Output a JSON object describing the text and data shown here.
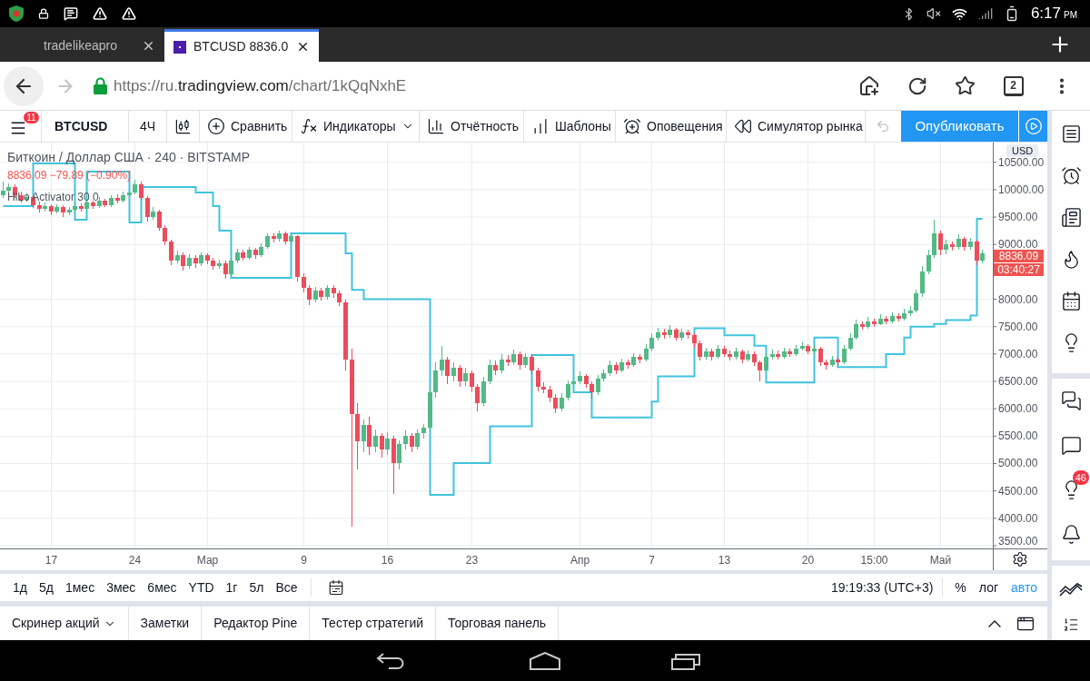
{
  "status_bar": {
    "time": "6:17",
    "period": "PM"
  },
  "browser": {
    "tabs": [
      {
        "title": "tradelikeapro",
        "favicon": false,
        "selected": false
      },
      {
        "title": "BTCUSD 8836.0",
        "favicon": true,
        "selected": true
      }
    ],
    "address_bar": {
      "back_enabled": true,
      "forward_enabled": false,
      "url": {
        "prefix": "https://ru.",
        "domain": "tradingview.com",
        "path": "/chart/1kQqNxhE"
      },
      "tab_count": "2"
    }
  },
  "toolbar": {
    "menu_badge": "11",
    "symbol": "BTCUSD",
    "interval": "4Ч",
    "items": [
      {
        "kind": "compare",
        "label": "Сравнить",
        "dropdown": false
      },
      {
        "kind": "indicators",
        "label": "Индикаторы",
        "dropdown": true
      },
      {
        "kind": "financials",
        "label": "Отчётность",
        "dropdown": false
      },
      {
        "kind": "templates",
        "label": "Шаблоны",
        "dropdown": false
      },
      {
        "kind": "alerts",
        "label": "Оповещения",
        "dropdown": false
      },
      {
        "kind": "replay",
        "label": "Симулятор рынка",
        "dropdown": false
      }
    ],
    "undo_enabled": false,
    "publish": "Опубликовать"
  },
  "chart": {
    "legend": {
      "title": "Биткоин / Доллар США · 240 · BITSTAMP",
      "change": "8836.09 −79.89 (−0.90%)",
      "indicator": "HiLo Activator 30 0"
    },
    "price_axis": {
      "currency": "USD",
      "last_price": "8836.09",
      "countdown": "03:40:27"
    },
    "chart_data": [
      {
        "type": "candlestick",
        "grid": true,
        "ylim": [
          3450,
          10860
        ],
        "yticks": [
          {
            "value": 3500,
            "label": "3500.00"
          },
          {
            "value": 4000,
            "label": "4000.00"
          },
          {
            "value": 4500,
            "label": "4500.00"
          },
          {
            "value": 5000,
            "label": "5000.00"
          },
          {
            "value": 5500,
            "label": "5500.00"
          },
          {
            "value": 6000,
            "label": "6000.00"
          },
          {
            "value": 6500,
            "label": "6500.00"
          },
          {
            "value": 7000,
            "label": "7000.00"
          },
          {
            "value": 7500,
            "label": "7500.00"
          },
          {
            "value": 8000,
            "label": "8000.00"
          },
          {
            "value": 9000,
            "label": "9000.00"
          },
          {
            "value": 9500,
            "label": "9500.00"
          },
          {
            "value": 10000,
            "label": "10000.00"
          },
          {
            "value": 10500,
            "label": "10500.00"
          }
        ],
        "categories": [
          null,
          null,
          null,
          null,
          null,
          null,
          null,
          null,
          "17",
          null,
          null,
          null,
          null,
          null,
          null,
          null,
          null,
          null,
          null,
          null,
          null,
          null,
          "24",
          null,
          null,
          null,
          null,
          null,
          null,
          null,
          null,
          null,
          null,
          null,
          "Мар",
          null,
          null,
          null,
          null,
          null,
          null,
          null,
          null,
          null,
          null,
          null,
          null,
          null,
          null,
          null,
          "9",
          null,
          null,
          null,
          null,
          null,
          null,
          null,
          null,
          null,
          null,
          null,
          null,
          null,
          "16",
          null,
          null,
          null,
          null,
          null,
          null,
          null,
          null,
          null,
          null,
          null,
          null,
          null,
          "23",
          null,
          null,
          null,
          null,
          null,
          null,
          null,
          null,
          null,
          null,
          null,
          null,
          null,
          null,
          null,
          null,
          null,
          "Апр",
          null,
          null,
          null,
          null,
          null,
          null,
          null,
          null,
          null,
          null,
          null,
          "7",
          null,
          null,
          null,
          null,
          null,
          null,
          null,
          null,
          null,
          null,
          null,
          "13",
          null,
          null,
          null,
          null,
          null,
          null,
          null,
          null,
          null,
          null,
          null,
          null,
          null,
          "20",
          null,
          null,
          null,
          null,
          null,
          null,
          null,
          null,
          null,
          null,
          "15:00",
          null,
          null,
          null,
          null,
          null,
          null,
          null,
          null,
          null,
          null,
          "Май",
          null,
          null,
          null,
          null,
          null,
          null,
          null
        ],
        "series": [
          {
            "type": "candlestick",
            "ohlc": [
              [
                9900,
                10150,
                9850,
                9980
              ],
              [
                9980,
                10120,
                9940,
                10050
              ],
              [
                10050,
                10100,
                9850,
                9900
              ],
              [
                9900,
                9960,
                9760,
                9820
              ],
              [
                9820,
                9930,
                9780,
                9870
              ],
              [
                9870,
                9900,
                9670,
                9720
              ],
              [
                9720,
                9780,
                9590,
                9650
              ],
              [
                9650,
                9760,
                9600,
                9700
              ],
              [
                9700,
                9740,
                9540,
                9600
              ],
              [
                9600,
                9730,
                9560,
                9680
              ],
              [
                9680,
                9720,
                9500,
                9580
              ],
              [
                9580,
                9690,
                9540,
                9630
              ],
              [
                9630,
                9760,
                9590,
                9700
              ],
              [
                9700,
                9750,
                9600,
                9650
              ],
              [
                9650,
                9810,
                9620,
                9760
              ],
              [
                9760,
                9800,
                9650,
                9700
              ],
              [
                9700,
                9860,
                9660,
                9800
              ],
              [
                9800,
                9840,
                9680,
                9720
              ],
              [
                9720,
                9900,
                9690,
                9850
              ],
              [
                9850,
                9910,
                9750,
                9800
              ],
              [
                9800,
                9960,
                9760,
                9900
              ],
              [
                9900,
                10020,
                9860,
                9950
              ],
              [
                9950,
                10180,
                9920,
                10100
              ],
              [
                10100,
                10140,
                9800,
                9850
              ],
              [
                9850,
                9880,
                9420,
                9500
              ],
              [
                9500,
                9680,
                9450,
                9600
              ],
              [
                9600,
                9640,
                9250,
                9300
              ],
              [
                9300,
                9350,
                8980,
                9050
              ],
              [
                9050,
                9080,
                8620,
                8700
              ],
              [
                8700,
                8880,
                8650,
                8800
              ],
              [
                8800,
                8850,
                8520,
                8600
              ],
              [
                8600,
                8820,
                8550,
                8750
              ],
              [
                8750,
                8800,
                8580,
                8650
              ],
              [
                8650,
                8860,
                8600,
                8800
              ],
              [
                8800,
                8840,
                8640,
                8700
              ],
              [
                8700,
                8750,
                8540,
                8600
              ],
              [
                8600,
                8720,
                8550,
                8650
              ],
              [
                8650,
                8700,
                8380,
                8450
              ],
              [
                8450,
                8760,
                8420,
                8700
              ],
              [
                8700,
                8920,
                8660,
                8850
              ],
              [
                8850,
                8900,
                8700,
                8750
              ],
              [
                8750,
                8960,
                8720,
                8900
              ],
              [
                8900,
                8940,
                8740,
                8800
              ],
              [
                8800,
                9020,
                8770,
                8950
              ],
              [
                8950,
                9200,
                8920,
                9150
              ],
              [
                9150,
                9210,
                9040,
                9100
              ],
              [
                9100,
                9250,
                9060,
                9200
              ],
              [
                9200,
                9240,
                9000,
                9050
              ],
              [
                9050,
                9200,
                9000,
                9150
              ],
              [
                9150,
                9170,
                8320,
                8400
              ],
              [
                8400,
                8480,
                8120,
                8200
              ],
              [
                8200,
                8260,
                7900,
                8000
              ],
              [
                8000,
                8230,
                7950,
                8150
              ],
              [
                8150,
                8200,
                7980,
                8050
              ],
              [
                8050,
                8260,
                8000,
                8200
              ],
              [
                8200,
                8250,
                8020,
                8100
              ],
              [
                8100,
                8160,
                7880,
                7950
              ],
              [
                7950,
                8000,
                6700,
                6900
              ],
              [
                6900,
                7100,
                3850,
                5900
              ],
              [
                5900,
                6100,
                4900,
                5400
              ],
              [
                5400,
                5800,
                5200,
                5700
              ],
              [
                5700,
                5850,
                5150,
                5300
              ],
              [
                5300,
                5620,
                5200,
                5500
              ],
              [
                5500,
                5560,
                5100,
                5250
              ],
              [
                5250,
                5580,
                5150,
                5450
              ],
              [
                5450,
                5500,
                4450,
                5000
              ],
              [
                5000,
                5420,
                4900,
                5350
              ],
              [
                5350,
                5600,
                5250,
                5500
              ],
              [
                5500,
                5560,
                5200,
                5300
              ],
              [
                5300,
                5620,
                5250,
                5550
              ],
              [
                5550,
                5720,
                5450,
                5650
              ],
              [
                5650,
                6400,
                5600,
                6300
              ],
              [
                6300,
                6850,
                6200,
                6700
              ],
              [
                6700,
                7150,
                6600,
                6900
              ],
              [
                6900,
                6950,
                6450,
                6600
              ],
              [
                6600,
                6850,
                6500,
                6750
              ],
              [
                6750,
                6800,
                6400,
                6500
              ],
              [
                6500,
                6750,
                6420,
                6650
              ],
              [
                6650,
                6700,
                6300,
                6400
              ],
              [
                6400,
                6450,
                5950,
                6100
              ],
              [
                6100,
                6580,
                6050,
                6500
              ],
              [
                6500,
                6900,
                6450,
                6800
              ],
              [
                6800,
                6880,
                6620,
                6700
              ],
              [
                6700,
                7000,
                6650,
                6900
              ],
              [
                6900,
                6980,
                6780,
                6850
              ],
              [
                6850,
                7080,
                6800,
                7000
              ],
              [
                7000,
                7050,
                6720,
                6800
              ],
              [
                6800,
                7020,
                6750,
                6950
              ],
              [
                6950,
                7000,
                6620,
                6700
              ],
              [
                6700,
                6750,
                6320,
                6400
              ],
              [
                6400,
                6480,
                6280,
                6350
              ],
              [
                6350,
                6420,
                6120,
                6200
              ],
              [
                6200,
                6260,
                5920,
                6000
              ],
              [
                6000,
                6280,
                5960,
                6200
              ],
              [
                6200,
                6520,
                6150,
                6450
              ],
              [
                6450,
                6580,
                6380,
                6500
              ],
              [
                6500,
                6680,
                6450,
                6600
              ],
              [
                6600,
                6640,
                6380,
                6450
              ],
              [
                6450,
                6500,
                6180,
                6300
              ],
              [
                6300,
                6620,
                6250,
                6550
              ],
              [
                6550,
                6720,
                6500,
                6650
              ],
              [
                6650,
                6880,
                6600,
                6800
              ],
              [
                6800,
                6850,
                6640,
                6700
              ],
              [
                6700,
                6920,
                6660,
                6850
              ],
              [
                6850,
                6900,
                6740,
                6800
              ],
              [
                6800,
                7020,
                6760,
                6950
              ],
              [
                6950,
                7000,
                6840,
                6900
              ],
              [
                6900,
                7180,
                6860,
                7100
              ],
              [
                7100,
                7380,
                7050,
                7300
              ],
              [
                7300,
                7480,
                7250,
                7400
              ],
              [
                7400,
                7460,
                7280,
                7350
              ],
              [
                7350,
                7520,
                7300,
                7450
              ],
              [
                7450,
                7480,
                7240,
                7300
              ],
              [
                7300,
                7460,
                7250,
                7400
              ],
              [
                7400,
                7440,
                7280,
                7350
              ],
              [
                7350,
                7380,
                7120,
                7200
              ],
              [
                7200,
                7240,
                6880,
                6950
              ],
              [
                6950,
                7120,
                6900,
                7050
              ],
              [
                7050,
                7090,
                6880,
                6950
              ],
              [
                6950,
                7160,
                6920,
                7100
              ],
              [
                7100,
                7140,
                6940,
                7000
              ],
              [
                7000,
                7060,
                6880,
                6950
              ],
              [
                6950,
                7110,
                6900,
                7050
              ],
              [
                7050,
                7080,
                6840,
                6900
              ],
              [
                6900,
                7060,
                6860,
                7000
              ],
              [
                7000,
                7040,
                6780,
                6850
              ],
              [
                6850,
                6880,
                6500,
                6700
              ],
              [
                6700,
                7000,
                6660,
                6950
              ],
              [
                6950,
                7080,
                6900,
                7000
              ],
              [
                7000,
                7060,
                6900,
                6950
              ],
              [
                6950,
                7110,
                6910,
                7050
              ],
              [
                7050,
                7100,
                6940,
                7000
              ],
              [
                7000,
                7160,
                6960,
                7100
              ],
              [
                7100,
                7220,
                7060,
                7150
              ],
              [
                7150,
                7180,
                7000,
                7050
              ],
              [
                7050,
                7160,
                7000,
                7100
              ],
              [
                7100,
                7130,
                6780,
                6850
              ],
              [
                6850,
                6900,
                6720,
                6800
              ],
              [
                6800,
                6960,
                6760,
                6900
              ],
              [
                6900,
                6940,
                6780,
                6850
              ],
              [
                6850,
                7160,
                6820,
                7100
              ],
              [
                7100,
                7380,
                7060,
                7300
              ],
              [
                7300,
                7620,
                7260,
                7550
              ],
              [
                7550,
                7600,
                7440,
                7500
              ],
              [
                7500,
                7680,
                7460,
                7600
              ],
              [
                7600,
                7640,
                7490,
                7550
              ],
              [
                7550,
                7720,
                7520,
                7650
              ],
              [
                7650,
                7700,
                7540,
                7600
              ],
              [
                7600,
                7760,
                7560,
                7700
              ],
              [
                7700,
                7740,
                7600,
                7650
              ],
              [
                7650,
                7820,
                7610,
                7750
              ],
              [
                7750,
                7880,
                7700,
                7800
              ],
              [
                7800,
                8180,
                7760,
                8100
              ],
              [
                8100,
                8600,
                8050,
                8500
              ],
              [
                8500,
                8900,
                8450,
                8800
              ],
              [
                8800,
                9450,
                8750,
                9200
              ],
              [
                9200,
                9250,
                8800,
                8900
              ],
              [
                8900,
                9080,
                8820,
                9000
              ],
              [
                9000,
                9060,
                8880,
                8950
              ],
              [
                8950,
                9180,
                8900,
                9100
              ],
              [
                9100,
                9130,
                8880,
                8950
              ],
              [
                8950,
                9120,
                8900,
                9050
              ],
              [
                9050,
                9080,
                8620,
                8700
              ],
              [
                8700,
                8900,
                8650,
                8836.09
              ]
            ]
          },
          {
            "type": "step",
            "color": "#40c4dc",
            "values": [
              9700,
              9700,
              9700,
              9700,
              9700,
              10480,
              10480,
              10480,
              10480,
              10480,
              10480,
              10480,
              9450,
              9450,
              10330,
              10330,
              10330,
              10330,
              10330,
              10330,
              10330,
              9400,
              9400,
              10050,
              10050,
              10050,
              10050,
              10050,
              10050,
              10050,
              10050,
              10050,
              9950,
              9950,
              9950,
              9700,
              9250,
              9250,
              8390,
              8390,
              8390,
              8390,
              8390,
              8390,
              8390,
              8390,
              8390,
              8390,
              9200,
              9200,
              9200,
              9200,
              9200,
              9200,
              9200,
              9200,
              9200,
              8840,
              8170,
              8170,
              8000,
              8000,
              8000,
              8000,
              8000,
              8000,
              8000,
              8000,
              8000,
              8000,
              8000,
              4430,
              4430,
              4430,
              4430,
              5010,
              5010,
              5010,
              5010,
              5010,
              5010,
              5680,
              5680,
              5680,
              5680,
              5680,
              5680,
              5680,
              6980,
              6980,
              6980,
              6980,
              6980,
              6980,
              6980,
              6300,
              6300,
              6300,
              5840,
              5840,
              5840,
              5840,
              5840,
              5840,
              5840,
              5840,
              5840,
              5840,
              6130,
              6590,
              6590,
              6590,
              6590,
              6590,
              6590,
              7470,
              7470,
              7470,
              7470,
              7470,
              7340,
              7340,
              7340,
              7340,
              7340,
              7150,
              7150,
              6480,
              6480,
              6480,
              6480,
              6480,
              6480,
              6480,
              6480,
              7300,
              7300,
              7300,
              7300,
              6760,
              6760,
              6760,
              6760,
              6760,
              6760,
              6760,
              6760,
              7000,
              7000,
              7000,
              7300,
              7500,
              7500,
              7500,
              7500,
              7550,
              7550,
              7620,
              7620,
              7620,
              7620,
              7700,
              9470,
              9470
            ]
          }
        ]
      }
    ]
  },
  "range_bar": {
    "ranges": [
      "1д",
      "5д",
      "1мес",
      "3мес",
      "6мес",
      "YTD",
      "1г",
      "5л",
      "Все"
    ],
    "time": "19:19:33 (UTC+3)",
    "scale_toggles": [
      {
        "label": "%",
        "on": false
      },
      {
        "label": "лог",
        "on": false
      },
      {
        "label": "авто",
        "on": true
      }
    ]
  },
  "bottom_panel": {
    "tabs": [
      {
        "label": "Скринер акций",
        "dropdown": true
      },
      {
        "label": "Заметки",
        "dropdown": false
      },
      {
        "label": "Редактор Pine",
        "dropdown": false
      },
      {
        "label": "Тестер стратегий",
        "dropdown": false
      },
      {
        "label": "Торговая панель",
        "dropdown": false
      }
    ]
  },
  "sidebar": {
    "badge": "46"
  }
}
